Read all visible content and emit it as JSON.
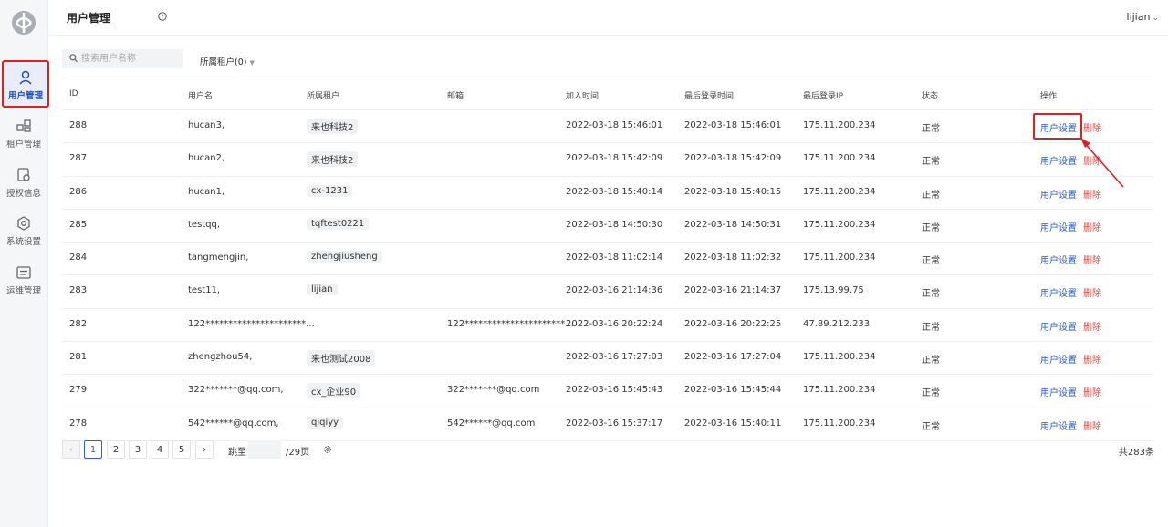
{
  "header": {
    "title": "用户管理",
    "username": "lijian"
  },
  "sidebar": {
    "items": [
      {
        "label": "用户管理",
        "icon": "user-icon",
        "active": true
      },
      {
        "label": "租户管理",
        "icon": "tenant-icon",
        "active": false
      },
      {
        "label": "授权信息",
        "icon": "license-icon",
        "active": false
      },
      {
        "label": "系统设置",
        "icon": "settings-icon",
        "active": false
      },
      {
        "label": "运维管理",
        "icon": "ops-icon",
        "active": false
      }
    ]
  },
  "filters": {
    "search_placeholder": "搜索用户名称",
    "tenant_filter_label": "所属租户(0)"
  },
  "table": {
    "columns": [
      "ID",
      "用户名",
      "所属租户",
      "邮箱",
      "加入时间",
      "最后登录时间",
      "最后登录IP",
      "状态",
      "操作"
    ],
    "action_set_label": "用户设置",
    "action_delete_label": "删除",
    "rows": [
      {
        "id": "288",
        "username": "hucan3,",
        "tenant": "来也科技2",
        "email": "",
        "joined": "2022-03-18 15:46:01",
        "last_login": "2022-03-18 15:46:01",
        "ip": "175.11.200.234",
        "status": "正常"
      },
      {
        "id": "287",
        "username": "hucan2,",
        "tenant": "来也科技2",
        "email": "",
        "joined": "2022-03-18 15:42:09",
        "last_login": "2022-03-18 15:42:09",
        "ip": "175.11.200.234",
        "status": "正常"
      },
      {
        "id": "286",
        "username": "hucan1,",
        "tenant": "cx-1231",
        "email": "",
        "joined": "2022-03-18 15:40:14",
        "last_login": "2022-03-18 15:40:15",
        "ip": "175.11.200.234",
        "status": "正常"
      },
      {
        "id": "285",
        "username": "testqq,",
        "tenant": "tqftest0221",
        "email": "",
        "joined": "2022-03-18 14:50:30",
        "last_login": "2022-03-18 14:50:31",
        "ip": "175.11.200.234",
        "status": "正常"
      },
      {
        "id": "284",
        "username": "tangmengjin,",
        "tenant": "zhengjiusheng",
        "email": "",
        "joined": "2022-03-18 11:02:14",
        "last_login": "2022-03-18 11:02:32",
        "ip": "175.11.200.234",
        "status": "正常"
      },
      {
        "id": "283",
        "username": "test11,",
        "tenant": "lijian",
        "email": "",
        "joined": "2022-03-16 21:14:36",
        "last_login": "2022-03-16 21:14:37",
        "ip": "175.13.99.75",
        "status": "正常"
      },
      {
        "id": "282",
        "username": "122**********************...",
        "tenant": "",
        "email": "122**********************...",
        "joined": "2022-03-16 20:22:24",
        "last_login": "2022-03-16 20:22:25",
        "ip": "47.89.212.233",
        "status": "正常"
      },
      {
        "id": "281",
        "username": "zhengzhou54,",
        "tenant": "来也测试2008",
        "email": "",
        "joined": "2022-03-16 17:27:03",
        "last_login": "2022-03-16 17:27:04",
        "ip": "175.11.200.234",
        "status": "正常"
      },
      {
        "id": "279",
        "username": "322*******@qq.com,",
        "tenant": "cx_企业90",
        "email": "322*******@qq.com",
        "joined": "2022-03-16 15:45:43",
        "last_login": "2022-03-16 15:45:44",
        "ip": "175.11.200.234",
        "status": "正常"
      },
      {
        "id": "278",
        "username": "542******@qq.com,",
        "tenant": "qiqiyy",
        "email": "542******@qq.com",
        "joined": "2022-03-16 15:37:17",
        "last_login": "2022-03-16 15:40:11",
        "ip": "175.11.200.234",
        "status": "正常"
      }
    ]
  },
  "pagination": {
    "prev": "‹",
    "next": "›",
    "pages": [
      "1",
      "2",
      "3",
      "4",
      "5"
    ],
    "current": "1",
    "jump_label": "跳至",
    "total_pages_label": "/29页",
    "total_label": "共283条"
  },
  "colors": {
    "link": "#2d5bd8",
    "danger": "#e0463c",
    "highlight": "#e02020"
  }
}
